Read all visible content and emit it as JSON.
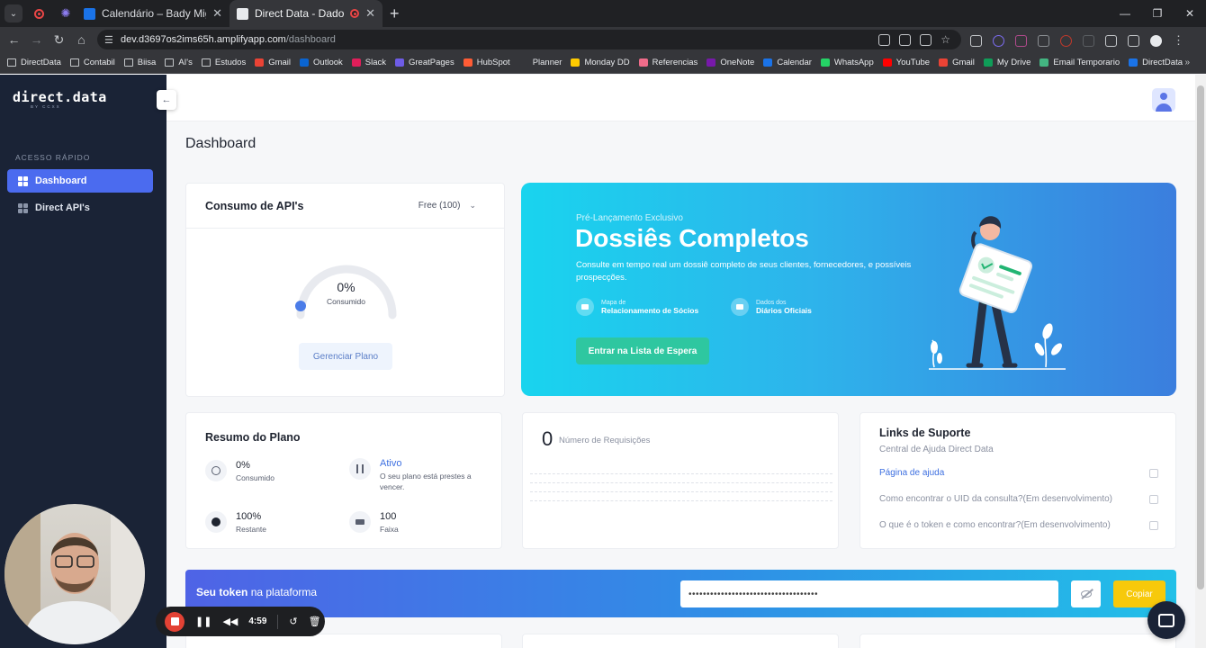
{
  "browser": {
    "tabs": [
      {
        "title": "Calendário – Bady Miguel – Ou",
        "fav_color": "#1a73e8",
        "active": false
      },
      {
        "title": "Direct Data - Dados com Ve",
        "fav_color": "#e8eaed",
        "active": true
      }
    ],
    "url_host": "dev.d3697os2ims65h.amplifyapp.com",
    "url_path": "/dashboard",
    "bookmarks": [
      {
        "label": "DirectData",
        "type": "folder",
        "color": "#c4c7ca"
      },
      {
        "label": "Contabil",
        "type": "folder",
        "color": "#c4c7ca"
      },
      {
        "label": "Biisa",
        "type": "folder",
        "color": "#c4c7ca"
      },
      {
        "label": "AI's",
        "type": "folder",
        "color": "#c4c7ca"
      },
      {
        "label": "Estudos",
        "type": "folder",
        "color": "#c4c7ca"
      },
      {
        "label": "Gmail",
        "type": "icon",
        "color": "#ea4335"
      },
      {
        "label": "Outlook",
        "type": "icon",
        "color": "#0a64d0"
      },
      {
        "label": "Slack",
        "type": "icon",
        "color": "#e01e5a"
      },
      {
        "label": "GreatPages",
        "type": "icon",
        "color": "#6e5ce6"
      },
      {
        "label": "HubSpot",
        "type": "icon",
        "color": "#ff5c35"
      },
      {
        "label": "Planner",
        "type": "icon",
        "color": "#35363a"
      },
      {
        "label": "Monday DD",
        "type": "icon",
        "color": "#ffcb00"
      },
      {
        "label": "Referencias",
        "type": "icon",
        "color": "#ef6c8a"
      },
      {
        "label": "OneNote",
        "type": "icon",
        "color": "#7719aa"
      },
      {
        "label": "Calendar",
        "type": "icon",
        "color": "#1a73e8"
      },
      {
        "label": "WhatsApp",
        "type": "icon",
        "color": "#25d366"
      },
      {
        "label": "YouTube",
        "type": "icon",
        "color": "#ff0000"
      },
      {
        "label": "Gmail",
        "type": "icon",
        "color": "#ea4335"
      },
      {
        "label": "My Drive",
        "type": "icon",
        "color": "#0f9d58"
      },
      {
        "label": "Email Temporario",
        "type": "icon",
        "color": "#43b581"
      },
      {
        "label": "DirectData",
        "type": "icon",
        "color": "#1a73e8"
      }
    ]
  },
  "sidebar": {
    "logo": "direct.data",
    "logo_sub": "BY CCXX",
    "section_title": "ACESSO RÁPIDO",
    "items": [
      {
        "label": "Dashboard",
        "active": true
      },
      {
        "label": "Direct API's",
        "active": false
      }
    ]
  },
  "main": {
    "page_title": "Dashboard"
  },
  "api_card": {
    "title": "Consumo de API's",
    "plan": "Free (100)",
    "gauge_value": "0%",
    "gauge_label": "Consumido",
    "gauge_fraction": 0,
    "manage_button": "Gerenciar Plano"
  },
  "promo": {
    "pre_title": "Pré-Lançamento Exclusivo",
    "title": "Dossiês Completos",
    "description": "Consulte em tempo real um dossiê completo de seus clientes, fornecedores, e possíveis prospecções.",
    "features": [
      {
        "top": "Mapa de",
        "bottom": "Relacionamento de Sócios"
      },
      {
        "top": "Dados dos",
        "bottom": "Diários Oficiais"
      }
    ],
    "cta": "Entrar na Lista de Espera"
  },
  "plan_summary": {
    "title": "Resumo do Plano",
    "stats": [
      {
        "value": "0%",
        "label": "Consumido"
      },
      {
        "value": "Ativo",
        "label": "O seu plano está prestes a vencer."
      },
      {
        "value": "100%",
        "label": "Restante"
      },
      {
        "value": "100",
        "label": "Faixa"
      }
    ]
  },
  "requests": {
    "count": "0",
    "label": "Número de Requisições"
  },
  "support": {
    "title": "Links de Suporte",
    "subtitle": "Central de Ajuda Direct Data",
    "links": [
      {
        "label": "Página de ajuda"
      },
      {
        "label": "Como encontrar o UID da consulta?(Em desenvolvimento)"
      },
      {
        "label": "O que é o token e como encontrar?(Em desenvolvimento)"
      }
    ]
  },
  "token": {
    "label_bold": "Seu token",
    "label_rest": " na plataforma",
    "masked_value": "••••••••••••••••••••••••••••••••••••",
    "copy_button": "Copiar"
  },
  "recorder": {
    "time": "4:59"
  },
  "colors": {
    "sidebar_bg": "#1a2336",
    "accent": "#4b6bef",
    "promo_cta": "#2ec7a0",
    "copy_button": "#f7c90b"
  }
}
